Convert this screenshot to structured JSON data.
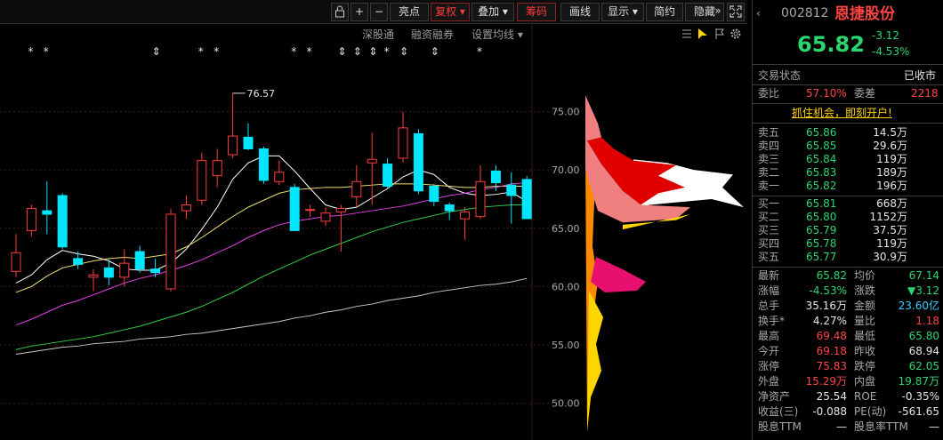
{
  "toolbar": {
    "lock_icon": "lock-icon",
    "plus_label": "+",
    "minus_label": "−",
    "highlight_label": "亮点",
    "fuquan_label": "复权",
    "overlay_label": "叠加",
    "chips_label": "筹码",
    "draw_label": "画线",
    "display_label": "显示",
    "simple_label": "简约",
    "hide_label": "隐藏",
    "collapse_label": "»",
    "fullscreen_icon": "fullscreen-icon"
  },
  "subbar": {
    "shenguangtong": "深股通",
    "margin": "融资融券",
    "ma_settings": "设置均线"
  },
  "chart_data": {
    "type": "candlestick",
    "max_label": "76.57",
    "event_markers": [
      "*",
      "*",
      "⇕",
      "*",
      "*",
      "*",
      "*",
      "⇕",
      "⇕",
      "⇕",
      "*",
      "⇕",
      "⇕",
      "*"
    ],
    "price_axis": {
      "ticks": [
        "50.00",
        "55.00",
        "60.00",
        "65.00",
        "70.00",
        "75.00"
      ],
      "range": [
        47.0,
        79.0
      ]
    },
    "candles": [
      {
        "o": 61.3,
        "h": 64.5,
        "l": 60.8,
        "c": 62.9
      },
      {
        "o": 64.8,
        "h": 67.0,
        "l": 64.3,
        "c": 66.7
      },
      {
        "o": 66.5,
        "h": 69.0,
        "l": 64.5,
        "c": 66.2
      },
      {
        "o": 67.8,
        "h": 68.0,
        "l": 63.2,
        "c": 63.4
      },
      {
        "o": 62.4,
        "h": 63.0,
        "l": 61.5,
        "c": 61.9
      },
      {
        "o": 60.8,
        "h": 61.5,
        "l": 59.6,
        "c": 61.0
      },
      {
        "o": 61.6,
        "h": 62.3,
        "l": 60.1,
        "c": 60.8
      },
      {
        "o": 60.8,
        "h": 63.2,
        "l": 60.0,
        "c": 62.0
      },
      {
        "o": 63.0,
        "h": 63.5,
        "l": 61.2,
        "c": 61.5
      },
      {
        "o": 61.5,
        "h": 62.4,
        "l": 60.8,
        "c": 61.2
      },
      {
        "o": 59.8,
        "h": 66.7,
        "l": 59.6,
        "c": 66.2
      },
      {
        "o": 66.5,
        "h": 67.8,
        "l": 65.8,
        "c": 67.0
      },
      {
        "o": 67.4,
        "h": 71.5,
        "l": 67.0,
        "c": 70.8
      },
      {
        "o": 69.5,
        "h": 71.8,
        "l": 68.5,
        "c": 70.8
      },
      {
        "o": 71.3,
        "h": 76.57,
        "l": 71.0,
        "c": 72.9
      },
      {
        "o": 72.8,
        "h": 74.0,
        "l": 71.7,
        "c": 71.8
      },
      {
        "o": 71.8,
        "h": 72.0,
        "l": 68.8,
        "c": 69.1
      },
      {
        "o": 69.0,
        "h": 70.8,
        "l": 68.7,
        "c": 69.8
      },
      {
        "o": 68.5,
        "h": 68.8,
        "l": 64.8,
        "c": 64.8
      },
      {
        "o": 66.6,
        "h": 67.0,
        "l": 66.0,
        "c": 66.6
      },
      {
        "o": 65.6,
        "h": 66.8,
        "l": 65.2,
        "c": 66.3
      },
      {
        "o": 66.4,
        "h": 67.0,
        "l": 63.0,
        "c": 66.7
      },
      {
        "o": 67.7,
        "h": 70.4,
        "l": 66.8,
        "c": 69.0
      },
      {
        "o": 70.6,
        "h": 73.2,
        "l": 67.0,
        "c": 70.9
      },
      {
        "o": 70.5,
        "h": 71.0,
        "l": 68.4,
        "c": 68.6
      },
      {
        "o": 71.0,
        "h": 75.0,
        "l": 70.6,
        "c": 73.6
      },
      {
        "o": 73.1,
        "h": 73.5,
        "l": 67.9,
        "c": 68.2
      },
      {
        "o": 68.6,
        "h": 68.8,
        "l": 66.9,
        "c": 67.3
      },
      {
        "o": 67.0,
        "h": 67.2,
        "l": 65.7,
        "c": 66.5
      },
      {
        "o": 65.8,
        "h": 66.8,
        "l": 64.0,
        "c": 66.4
      },
      {
        "o": 66.0,
        "h": 70.4,
        "l": 65.8,
        "c": 69.0
      },
      {
        "o": 69.9,
        "h": 70.4,
        "l": 68.2,
        "c": 68.9
      },
      {
        "o": 68.7,
        "h": 69.8,
        "l": 65.4,
        "c": 67.8
      },
      {
        "o": 69.18,
        "h": 69.48,
        "l": 65.8,
        "c": 65.82
      }
    ],
    "ma_lines": [
      {
        "color": "#ffffff",
        "values": [
          60.3,
          61.0,
          62.3,
          63.1,
          62.8,
          62.6,
          62.2,
          61.5,
          61.4,
          61.4,
          62.0,
          63.2,
          64.9,
          66.8,
          69.2,
          70.6,
          71.2,
          71.2,
          69.9,
          68.4,
          67.0,
          66.6,
          66.8,
          67.6,
          68.4,
          69.4,
          70.0,
          69.6,
          68.5,
          68.0,
          67.8,
          67.9,
          68.1,
          67.3
        ]
      },
      {
        "color": "#f0e070",
        "values": [
          59.5,
          60.0,
          60.9,
          61.6,
          61.9,
          62.2,
          62.4,
          62.5,
          62.4,
          62.6,
          62.8,
          63.4,
          64.2,
          65.1,
          66.0,
          66.8,
          67.4,
          68.0,
          68.3,
          68.4,
          68.5,
          68.5,
          68.6,
          68.7,
          68.8,
          68.8,
          68.8,
          68.7,
          68.6,
          68.5,
          68.5,
          68.6,
          68.6,
          68.6
        ]
      },
      {
        "color": "#e43fe4",
        "values": [
          56.7,
          57.2,
          57.8,
          58.4,
          58.8,
          59.3,
          59.8,
          60.3,
          60.7,
          61.0,
          61.4,
          61.8,
          62.3,
          62.9,
          63.5,
          64.2,
          64.8,
          65.3,
          65.6,
          65.8,
          66.0,
          66.1,
          66.3,
          66.5,
          66.7,
          66.9,
          67.2,
          67.5,
          67.8,
          68.0,
          68.3,
          68.5,
          68.8,
          68.9
        ]
      },
      {
        "color": "#2fcf4a",
        "values": [
          54.6,
          54.9,
          55.1,
          55.3,
          55.5,
          55.7,
          56.0,
          56.3,
          56.6,
          57.0,
          57.4,
          57.8,
          58.3,
          58.9,
          59.5,
          60.2,
          60.9,
          61.5,
          62.1,
          62.7,
          63.2,
          63.7,
          64.2,
          64.7,
          65.1,
          65.5,
          65.8,
          66.1,
          66.4,
          66.6,
          66.8,
          66.9,
          67.0,
          67.0
        ]
      },
      {
        "color": "#c8c8c8",
        "values": [
          54.2,
          54.4,
          54.6,
          54.8,
          54.9,
          55.1,
          55.2,
          55.3,
          55.5,
          55.6,
          55.7,
          55.9,
          56.0,
          56.2,
          56.4,
          56.6,
          56.8,
          57.0,
          57.3,
          57.5,
          57.8,
          58.0,
          58.3,
          58.5,
          58.8,
          59.0,
          59.2,
          59.5,
          59.7,
          59.9,
          60.1,
          60.2,
          60.4,
          60.7
        ]
      }
    ]
  },
  "stock": {
    "code": "002812",
    "name": "恩捷股份",
    "price": "65.82",
    "change": "-3.12",
    "change_pct": "-4.53%",
    "trade_status_label": "交易状态",
    "trade_status": "已收市",
    "weibi_label": "委比",
    "weibi": "57.10%",
    "weicha_label": "委差",
    "weicha": "2218",
    "promo": "抓住机会，即刻开户!",
    "asks": [
      {
        "label": "卖五",
        "price": "65.86",
        "vol": "14.5万"
      },
      {
        "label": "卖四",
        "price": "65.85",
        "vol": "29.6万"
      },
      {
        "label": "卖三",
        "price": "65.84",
        "vol": "119万"
      },
      {
        "label": "卖二",
        "price": "65.83",
        "vol": "189万"
      },
      {
        "label": "卖一",
        "price": "65.82",
        "vol": "196万"
      }
    ],
    "bids": [
      {
        "label": "买一",
        "price": "65.81",
        "vol": "668万"
      },
      {
        "label": "买二",
        "price": "65.80",
        "vol": "1152万"
      },
      {
        "label": "买三",
        "price": "65.79",
        "vol": "37.5万"
      },
      {
        "label": "买四",
        "price": "65.78",
        "vol": "119万"
      },
      {
        "label": "买五",
        "price": "65.77",
        "vol": "30.9万"
      }
    ],
    "stats": [
      {
        "l1": "最新",
        "v1": "65.82",
        "c1": "grn",
        "l2": "均价",
        "v2": "67.14",
        "c2": "grn"
      },
      {
        "l1": "涨幅",
        "v1": "-4.53%",
        "c1": "grn",
        "l2": "涨跌",
        "v2": "▼3.12",
        "c2": "grn"
      },
      {
        "l1": "总手",
        "v1": "35.16万",
        "c1": "wht",
        "l2": "金额",
        "v2": "23.60亿",
        "c2": "cyn"
      },
      {
        "l1": "换手*",
        "v1": "4.27%",
        "c1": "wht",
        "l2": "量比",
        "v2": "1.18",
        "c2": "red"
      },
      {
        "l1": "最高",
        "v1": "69.48",
        "c1": "red",
        "l2": "最低",
        "v2": "65.80",
        "c2": "grn"
      },
      {
        "l1": "今开",
        "v1": "69.18",
        "c1": "red",
        "l2": "昨收",
        "v2": "68.94",
        "c2": "wht"
      },
      {
        "l1": "涨停",
        "v1": "75.83",
        "c1": "red",
        "l2": "跌停",
        "v2": "62.05",
        "c2": "grn"
      },
      {
        "l1": "外盘",
        "v1": "15.29万",
        "c1": "red",
        "l2": "内盘",
        "v2": "19.87万",
        "c2": "grn"
      },
      {
        "l1": "净资产",
        "v1": "25.54",
        "c1": "wht",
        "l2": "ROE",
        "v2": "-0.35%",
        "c2": "wht"
      },
      {
        "l1": "收益(三)",
        "v1": "-0.088",
        "c1": "wht",
        "l2": "PE(动)",
        "v2": "-561.65",
        "c2": "wht"
      },
      {
        "l1": "股息TTM",
        "v1": "—",
        "c1": "wht",
        "l2": "股息率TTM",
        "v2": "—",
        "c2": "wht"
      }
    ]
  }
}
